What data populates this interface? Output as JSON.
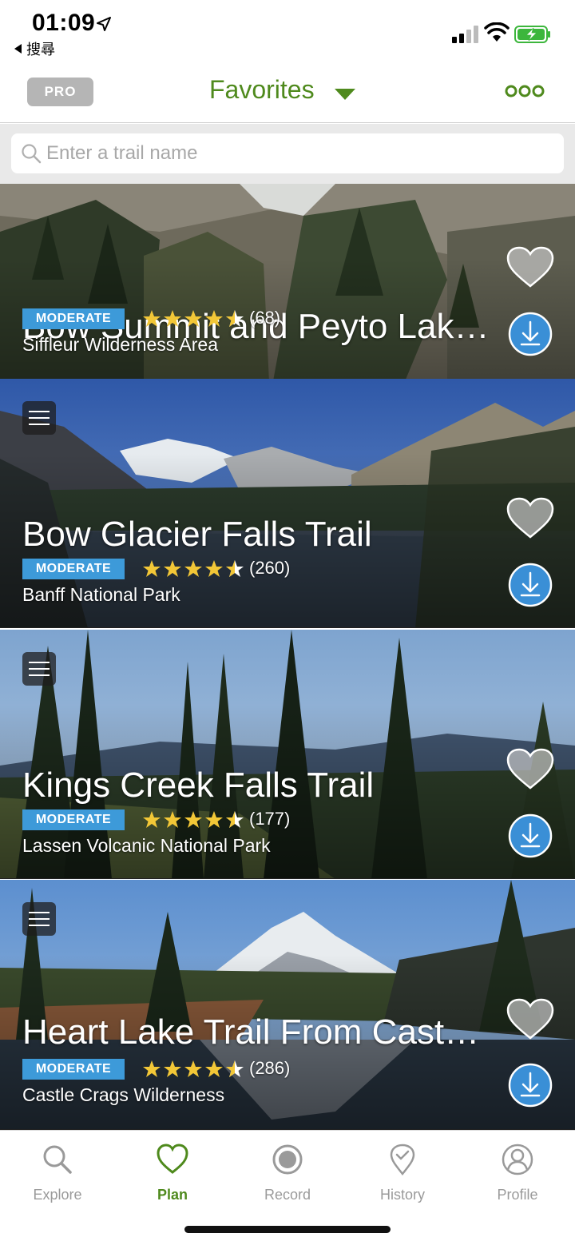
{
  "status_bar": {
    "time": "01:09",
    "back_app": "搜尋"
  },
  "nav": {
    "pro_label": "PRO",
    "title": "Favorites",
    "title_color": "#4f8a1d"
  },
  "search": {
    "placeholder": "Enter a trail name",
    "value": ""
  },
  "trails": [
    {
      "name": "Bow Summit and Peyto Lake...",
      "difficulty": "MODERATE",
      "rating": 4.5,
      "reviews": "(68)",
      "location": "Siffleur Wilderness Area"
    },
    {
      "name": "Bow Glacier Falls Trail",
      "difficulty": "MODERATE",
      "rating": 4.5,
      "reviews": "(260)",
      "location": "Banff National Park"
    },
    {
      "name": "Kings Creek Falls Trail",
      "difficulty": "MODERATE",
      "rating": 4.5,
      "reviews": "(177)",
      "location": "Lassen Volcanic National Park"
    },
    {
      "name": "Heart Lake Trail From Castle...",
      "difficulty": "MODERATE",
      "rating": 4.5,
      "reviews": "(286)",
      "location": "Castle Crags Wilderness"
    }
  ],
  "tabs": [
    {
      "label": "Explore",
      "icon": "search-icon"
    },
    {
      "label": "Plan",
      "icon": "heart-icon"
    },
    {
      "label": "Record",
      "icon": "record-icon"
    },
    {
      "label": "History",
      "icon": "location-check-icon"
    },
    {
      "label": "Profile",
      "icon": "user-icon"
    }
  ],
  "active_tab": "Plan",
  "colors": {
    "brand_green": "#4f8a1d",
    "badge_blue": "#3d9ad9",
    "download_blue": "#3a8fd6",
    "star_yellow": "#f2c737"
  }
}
